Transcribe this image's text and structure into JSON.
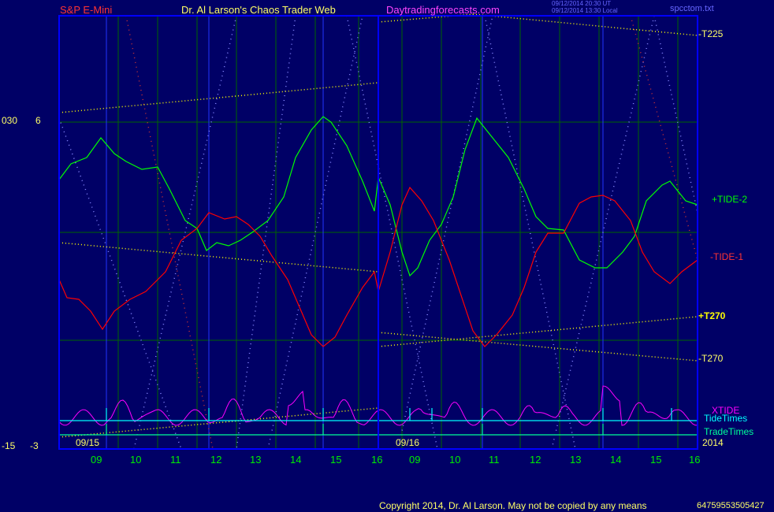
{
  "header": {
    "left": "S&P E-Mini",
    "center": "Dr. Al Larson's Chaos Trader Web",
    "site": "Daytradingforecasts.com",
    "time_utc": "09/12/2014 20:30 UT",
    "time_local": "09/12/2014 13:30 Local",
    "file": "spcctom.txt"
  },
  "left_axis": {
    "top_a": "030",
    "top_b": "6",
    "bottom_a": "-15",
    "bottom_b": "-3"
  },
  "footer": {
    "copyright": "Copyright 2014, Dr. Al Larson. May not be copied by any means",
    "code": "64759553505427"
  },
  "chart_data": {
    "type": "line",
    "x_ticks": [
      "09",
      "10",
      "11",
      "12",
      "13",
      "14",
      "15",
      "16",
      "09",
      "10",
      "11",
      "12",
      "13",
      "14",
      "15",
      "16"
    ],
    "date_labels": [
      "09/15",
      "09/16"
    ],
    "year_label": "2014",
    "series": [
      {
        "name": "+TIDE-2",
        "color": "#00ff00"
      },
      {
        "name": "-TIDE-1",
        "color": "#ff0000"
      },
      {
        "name": "XTIDE",
        "color": "#ff00ff"
      },
      {
        "name": "TideTimes",
        "color": "#00ffff"
      },
      {
        "name": "TradeTimes",
        "color": "#00ff99"
      }
    ],
    "lines": [
      {
        "name": "-T225",
        "color": "#ffff00"
      },
      {
        "name": "+T270",
        "color": "#ffff00"
      },
      {
        "name": "-T270",
        "color": "#ffff00"
      }
    ]
  },
  "colors": {
    "background": "#000066",
    "frame": "#0000ff",
    "grid": "#006600"
  }
}
